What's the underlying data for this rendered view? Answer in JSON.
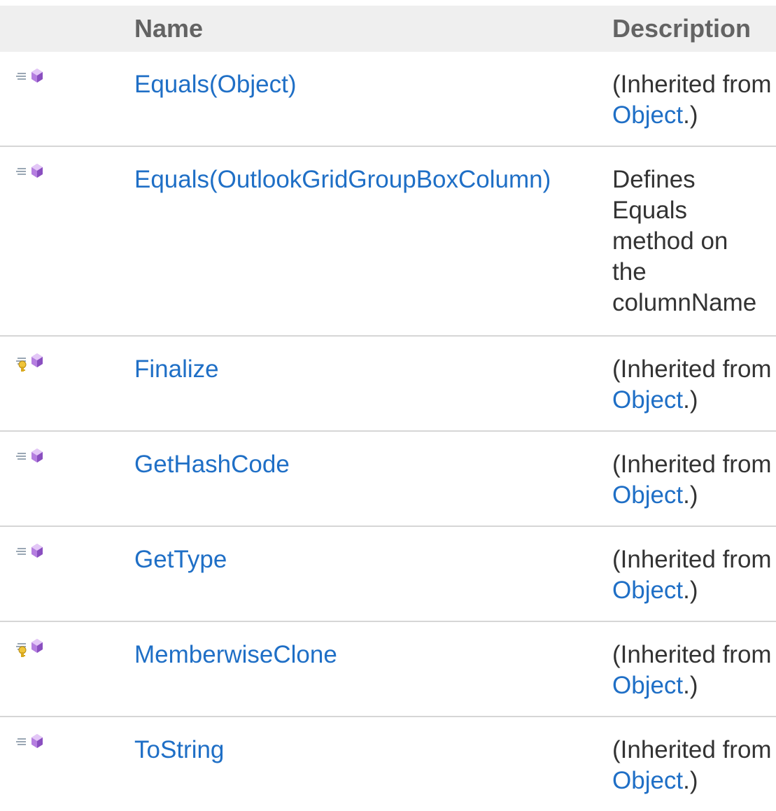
{
  "table": {
    "headers": {
      "icon": "",
      "name": "Name",
      "description": "Description"
    },
    "rows": [
      {
        "icon": "public-method-icon",
        "name": "Equals(Object)",
        "desc_prefix": "(Inherited from ",
        "desc_link": "Object",
        "desc_suffix": ".)"
      },
      {
        "icon": "public-method-icon",
        "name": "Equals(OutlookGridGroupBoxColumn)",
        "desc_lines": [
          "Defines",
          "Equals",
          "method on",
          "the",
          "columnName"
        ]
      },
      {
        "icon": "protected-method-icon",
        "name": "Finalize",
        "desc_prefix": "(Inherited from ",
        "desc_link": "Object",
        "desc_suffix": ".)"
      },
      {
        "icon": "public-method-icon",
        "name": "GetHashCode",
        "desc_prefix": "(Inherited from ",
        "desc_link": "Object",
        "desc_suffix": ".)"
      },
      {
        "icon": "public-method-icon",
        "name": "GetType",
        "desc_prefix": "(Inherited from ",
        "desc_link": "Object",
        "desc_suffix": ".)"
      },
      {
        "icon": "protected-method-icon",
        "name": "MemberwiseClone",
        "desc_prefix": "(Inherited from ",
        "desc_link": "Object",
        "desc_suffix": ".)"
      },
      {
        "icon": "public-method-icon",
        "name": "ToString",
        "desc_prefix": "(Inherited from ",
        "desc_link": "Object",
        "desc_suffix": ".)"
      }
    ]
  },
  "colors": {
    "link": "#1f6fc6",
    "header_bg": "#efefef",
    "header_text": "#636363",
    "row_divider": "#d6d6d6",
    "method_gem": "#a56ad6",
    "protected_key": "#e0b422"
  }
}
